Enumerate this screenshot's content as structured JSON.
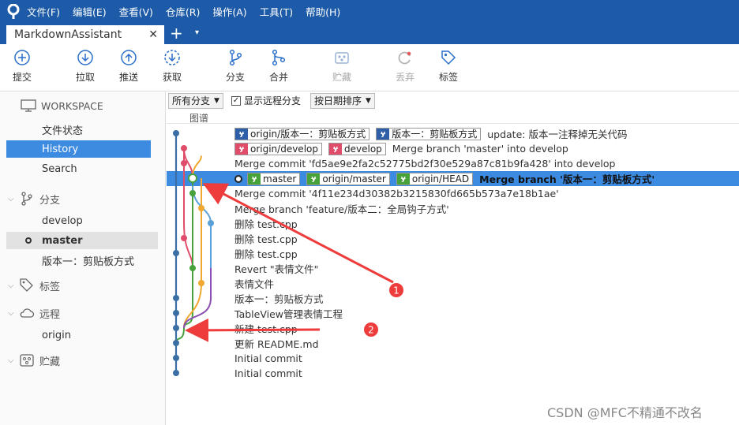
{
  "menu": [
    "文件(F)",
    "编辑(E)",
    "查看(V)",
    "仓库(R)",
    "操作(A)",
    "工具(T)",
    "帮助(H)"
  ],
  "tab": {
    "title": "MarkdownAssistant",
    "close": "✕",
    "add": "+",
    "dropdown": "▾"
  },
  "toolbar": {
    "commit": "提交",
    "pull": "拉取",
    "push": "推送",
    "fetch": "获取",
    "branch": "分支",
    "merge": "合并",
    "stash": "贮藏",
    "discard": "丢弃",
    "tag": "标签"
  },
  "sidebar": {
    "workspace": "WORKSPACE",
    "workspace_items": [
      "文件状态",
      "History",
      "Search"
    ],
    "branches": "分支",
    "branch_items": [
      "develop",
      "master",
      "版本一：剪贴板方式"
    ],
    "tags": "标签",
    "remotes": "远程",
    "remote_items": [
      "origin"
    ],
    "stashes": "贮藏"
  },
  "filter": {
    "all_branches": "所有分支",
    "show_remote": "显示远程分支",
    "sort": "按日期排序",
    "check": "✓"
  },
  "graph_header": "图谱",
  "commits": [
    {
      "badges": [
        {
          "c": "blue",
          "t": "origin/版本一：剪贴板方式"
        },
        {
          "c": "blue",
          "t": "版本一：剪贴板方式"
        }
      ],
      "msg": "update: 版本一注释掉无关代码"
    },
    {
      "badges": [
        {
          "c": "pink",
          "t": "origin/develop"
        },
        {
          "c": "pink",
          "t": "develop"
        }
      ],
      "msg": "Merge branch 'master' into develop"
    },
    {
      "badges": [],
      "msg": "Merge commit 'fd5ae9e2fa2c52775bd2f30e529a87c81b9fa428' into develop"
    },
    {
      "badges": [
        {
          "c": "green",
          "t": "master"
        },
        {
          "c": "green",
          "t": "origin/master"
        },
        {
          "c": "green",
          "t": "origin/HEAD"
        }
      ],
      "msg": "Merge branch '版本一：剪贴板方式'",
      "head": true
    },
    {
      "badges": [],
      "msg": "Merge commit '4f11e234d30382b3215830fd665b573a7e18b1ae'"
    },
    {
      "badges": [],
      "msg": "Merge branch 'feature/版本二：全局钩子方式'"
    },
    {
      "badges": [],
      "msg": "删除 test.cpp"
    },
    {
      "badges": [],
      "msg": "删除 test.cpp"
    },
    {
      "badges": [],
      "msg": "删除 test.cpp"
    },
    {
      "badges": [],
      "msg": "Revert \"表情文件\""
    },
    {
      "badges": [],
      "msg": "表情文件"
    },
    {
      "badges": [],
      "msg": "版本一：剪贴板方式"
    },
    {
      "badges": [],
      "msg": "TableView管理表情工程"
    },
    {
      "badges": [],
      "msg": "新建 test.cpp"
    },
    {
      "badges": [],
      "msg": "更新 README.md"
    },
    {
      "badges": [],
      "msg": "Initial commit"
    },
    {
      "badges": [],
      "msg": "Initial commit"
    }
  ],
  "annotations": [
    "1",
    "2"
  ],
  "watermark": "CSDN @MFC不精通不改名"
}
